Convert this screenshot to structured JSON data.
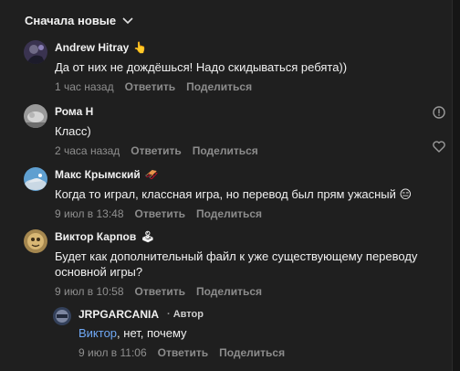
{
  "sort": {
    "label": "Сначала новые"
  },
  "actions": {
    "reply": "Ответить",
    "share": "Поделиться"
  },
  "comments": [
    {
      "author": "Andrew Hitray",
      "emoji": "👆",
      "text": "Да от них не дождёшься! Надо скидываться ребята))",
      "time": "1 час назад"
    },
    {
      "author": "Рома Н",
      "text": "Класс)",
      "time": "2 часа назад"
    },
    {
      "author": "Макс Крымский",
      "emoji": "🛷",
      "text": "Когда то играл, классная игра, но перевод был прям ужасный",
      "text_emoji": "😑",
      "time": "9 июл в 13:48"
    },
    {
      "author": "Виктор Карпов",
      "emoji": "🕹",
      "text_line1": "Будет как дополнительный файл к уже существующему переводу",
      "text_line2": "основной игры?",
      "time": "9 июл в 10:58"
    }
  ],
  "reply": {
    "author": "JRPGARCANIA",
    "author_badge": "Автор",
    "mention": "Виктор",
    "text": ", нет, почему",
    "time": "9 июл в 11:06"
  },
  "colors": {
    "background": "#1f1f1f",
    "mention": "#6fa8f5",
    "muted": "#8c8c8c"
  },
  "icons": [
    "chevron-down-icon",
    "report-icon",
    "like-heart-icon"
  ]
}
